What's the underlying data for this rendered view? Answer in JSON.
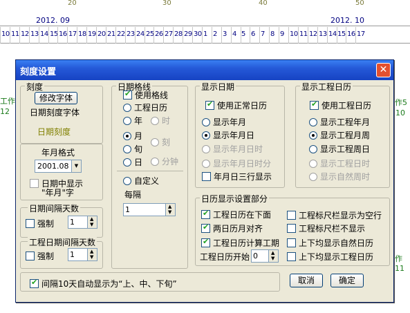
{
  "ruler": {
    "numbers": [
      "20",
      "30",
      "40",
      "50"
    ],
    "months": [
      "2012. 09",
      "2012. 10"
    ],
    "days_sep": [
      "10",
      "11",
      "12",
      "13",
      "14",
      "15",
      "16",
      "17",
      "18",
      "19",
      "20",
      "21",
      "22",
      "23",
      "24",
      "25",
      "26",
      "27",
      "28",
      "29",
      "30"
    ],
    "days_oct": [
      "1",
      "2",
      "3",
      "4",
      "5",
      "6",
      "7",
      "8",
      "9",
      "10",
      "11",
      "12",
      "13",
      "14",
      "15",
      "16",
      "17"
    ],
    "side_left_top": "工作2",
    "side_left_num": "12",
    "side_right_top": "作5",
    "side_right_num": "10",
    "side_right_bottom": "作11"
  },
  "dialog": {
    "title": "刻度设置",
    "close": "✕",
    "scale": {
      "label": "刻度",
      "font_button": "修改字体",
      "font_text": "日期刻度字体",
      "sample": "日期刻度",
      "sample_color": "#808000"
    },
    "year_month": {
      "label": "年月格式",
      "value": "2001.08",
      "show_line1": "日期中显示",
      "show_line2": "\"年月\"字"
    },
    "interval": {
      "label": "日期间隔天数",
      "force": "强制",
      "value": "1"
    },
    "work_interval": {
      "label": "工程日期间隔天数",
      "force": "强制",
      "value": "1"
    },
    "gridline": {
      "label": "日期格线",
      "use": "使用格线",
      "work": "工程日历",
      "year": "年",
      "hour": "时",
      "month": "月",
      "quarter": "刻",
      "ten_day": "旬",
      "minute": "分钟",
      "day": "日",
      "custom": "自定义",
      "every": "每隔",
      "every_value": "1"
    },
    "show_date": {
      "label": "显示日期",
      "use_normal": "使用正常日历",
      "opt1": "显示年月",
      "opt2": "显示年月日",
      "opt3": "显示年月日时",
      "opt4": "显示年月日时分",
      "three_rows": "年月日三行显示"
    },
    "show_work": {
      "label": "显示工程日历",
      "use_work": "使用工程日历",
      "opt1": "显示工程年月",
      "opt2": "显示工程月周",
      "opt3": "显示工程周日",
      "opt4": "显示工程日时",
      "opt5": "显示自然周时"
    },
    "calendar": {
      "label": "日历显示设置部分",
      "below": "工程日历在下面",
      "align": "两日历月对齐",
      "compute": "工程日历计算工期",
      "start": "工程日历开始",
      "start_value": "0",
      "empty_row": "工程标尺栏显示为空行",
      "hide": "工程标尺栏不显示",
      "natural": "上下均显示自然日历",
      "work": "上下均显示工程日历"
    },
    "auto_show": "间隔10天自动显示为“上、中、下旬”",
    "cancel": "取消",
    "ok": "确定"
  }
}
